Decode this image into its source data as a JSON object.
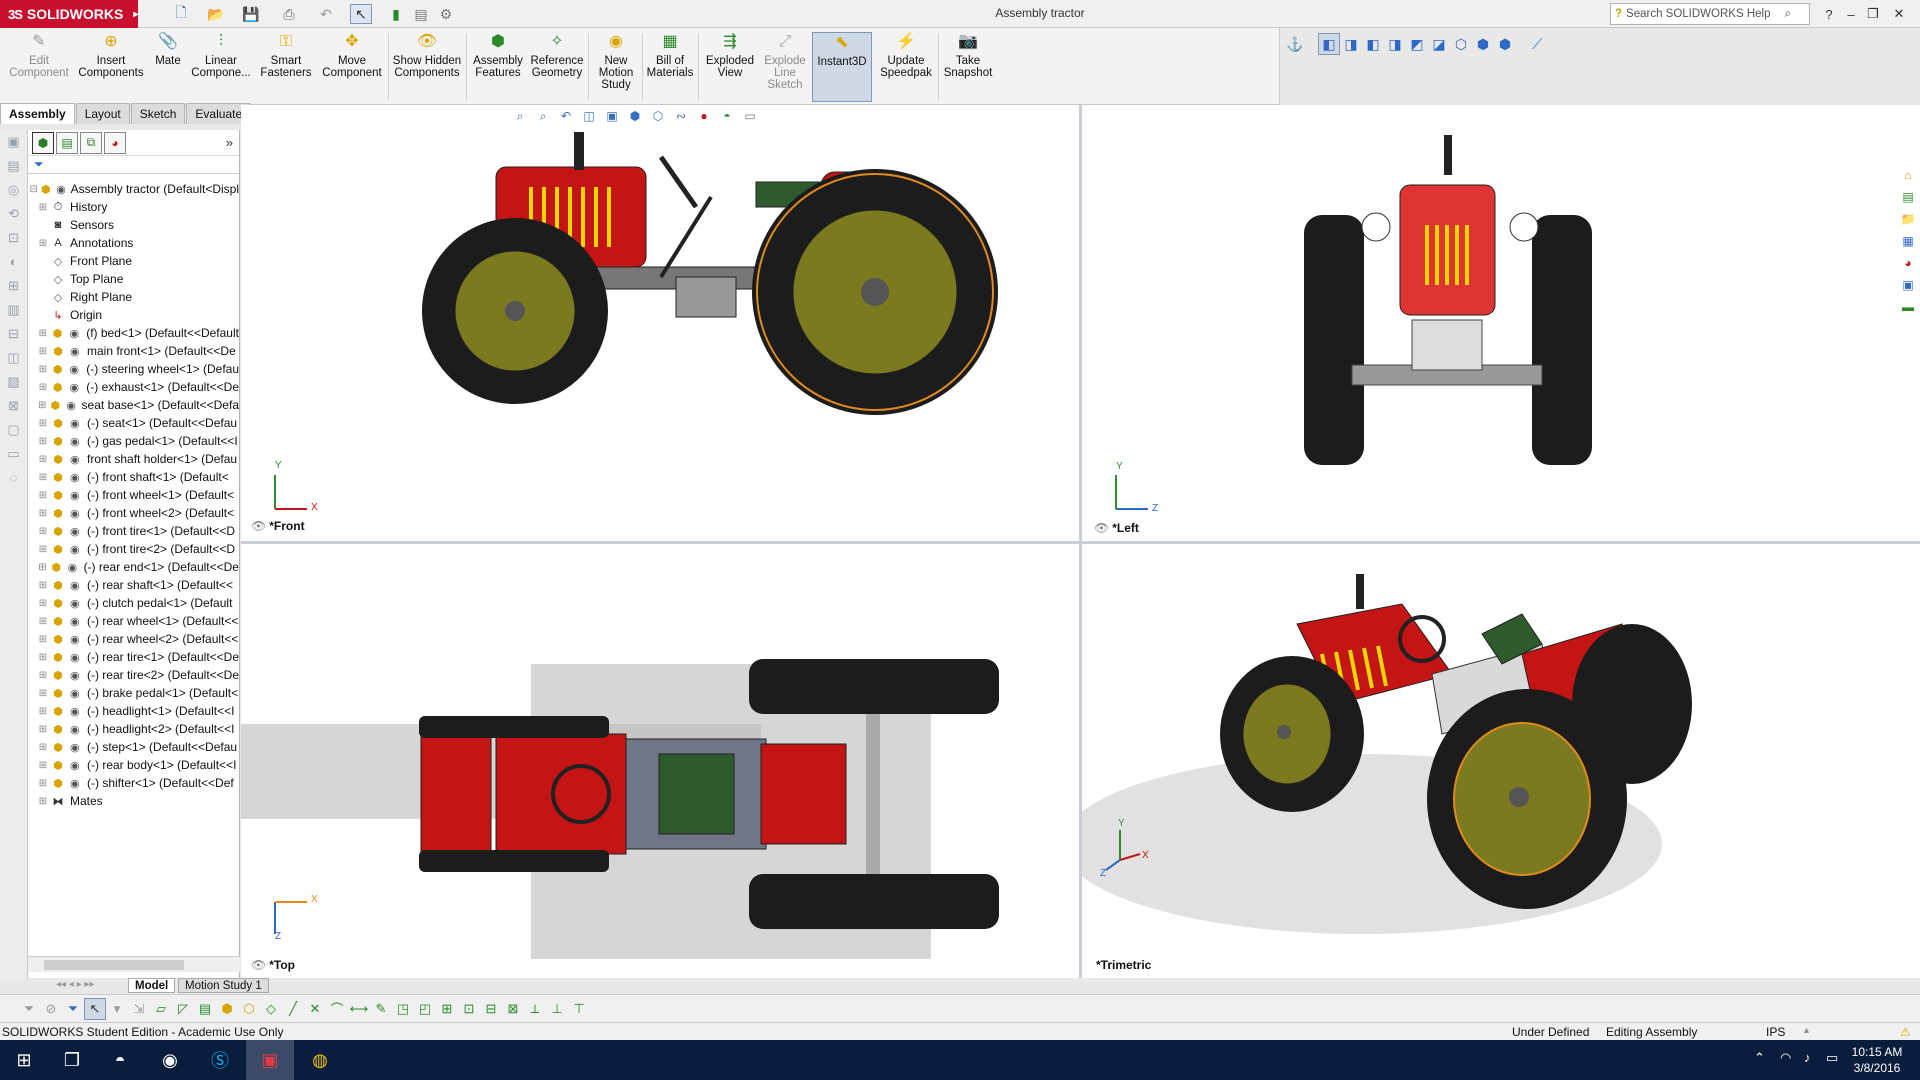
{
  "app": {
    "brand": "SOLIDWORKS",
    "brand_mark": "3S",
    "title": "Assembly tractor"
  },
  "colors": {
    "brand": "#c8102e",
    "tractor_red": "#c41414",
    "wheel_olive": "#7b7a1e",
    "tire": "#1c1c1c",
    "seat_green": "#2e5a2e",
    "accent_blue": "#2f69c5"
  },
  "quick_access": [
    "new-icon",
    "open-icon",
    "save-icon",
    "print-icon",
    "undo-icon",
    "select-icon",
    "rebuild-icon",
    "file-props-icon",
    "options-icon"
  ],
  "search": {
    "placeholder": "Search SOLIDWORKS Help"
  },
  "command_manager": [
    {
      "label": "Edit Component",
      "disabled": true
    },
    {
      "label": "Insert Components",
      "disabled": false
    },
    {
      "label": "Mate",
      "disabled": false
    },
    {
      "label": "Linear Compone...",
      "disabled": false
    },
    {
      "label": "Smart Fasteners",
      "disabled": false
    },
    {
      "label": "Move Component",
      "disabled": false
    },
    {
      "label": "Show Hidden Components",
      "disabled": false
    },
    {
      "label": "Assembly Features",
      "disabled": false
    },
    {
      "label": "Reference Geometry",
      "disabled": false
    },
    {
      "label": "New Motion Study",
      "disabled": false
    },
    {
      "label": "Bill of Materials",
      "disabled": false
    },
    {
      "label": "Exploded View",
      "disabled": false
    },
    {
      "label": "Explode Line Sketch",
      "disabled": true
    },
    {
      "label": "Instant3D",
      "disabled": false,
      "active": true
    },
    {
      "label": "Update Speedpak",
      "disabled": false
    },
    {
      "label": "Take Snapshot",
      "disabled": false
    }
  ],
  "tabs": [
    "Assembly",
    "Layout",
    "Sketch",
    "Evaluate"
  ],
  "feature_tree": {
    "root": "Assembly tractor  (Default<Displ",
    "items": [
      {
        "label": "History",
        "type": "history"
      },
      {
        "label": "Sensors",
        "type": "sensor"
      },
      {
        "label": "Annotations",
        "type": "annotation"
      },
      {
        "label": "Front Plane",
        "type": "plane"
      },
      {
        "label": "Top Plane",
        "type": "plane"
      },
      {
        "label": "Right Plane",
        "type": "plane"
      },
      {
        "label": "Origin",
        "type": "origin"
      },
      {
        "label": "(f) bed<1> (Default<<Default",
        "type": "part"
      },
      {
        "label": "main front<1> (Default<<De",
        "type": "part"
      },
      {
        "label": "(-) steering wheel<1> (Defau",
        "type": "part"
      },
      {
        "label": "(-) exhaust<1> (Default<<De",
        "type": "part"
      },
      {
        "label": "seat base<1> (Default<<Defa",
        "type": "part"
      },
      {
        "label": "(-) seat<1> (Default<<Defau",
        "type": "part"
      },
      {
        "label": "(-) gas pedal<1> (Default<<I",
        "type": "part"
      },
      {
        "label": "front shaft holder<1> (Defau",
        "type": "part"
      },
      {
        "label": "(-) front shaft<1> (Default<",
        "type": "part"
      },
      {
        "label": "(-) front wheel<1> (Default<",
        "type": "part"
      },
      {
        "label": "(-) front wheel<2> (Default<",
        "type": "part"
      },
      {
        "label": "(-) front tire<1> (Default<<D",
        "type": "part"
      },
      {
        "label": "(-) front tire<2> (Default<<D",
        "type": "part"
      },
      {
        "label": "(-) rear end<1> (Default<<De",
        "type": "part"
      },
      {
        "label": "(-) rear shaft<1> (Default<<",
        "type": "part"
      },
      {
        "label": "(-) clutch pedal<1> (Default",
        "type": "part"
      },
      {
        "label": "(-) rear wheel<1> (Default<<",
        "type": "part"
      },
      {
        "label": "(-) rear wheel<2> (Default<<",
        "type": "part"
      },
      {
        "label": "(-) rear tire<1> (Default<<De",
        "type": "part"
      },
      {
        "label": "(-) rear tire<2> (Default<<De",
        "type": "part"
      },
      {
        "label": "(-) brake pedal<1> (Default<",
        "type": "part"
      },
      {
        "label": "(-) headlight<1> (Default<<I",
        "type": "part"
      },
      {
        "label": "(-) headlight<2> (Default<<I",
        "type": "part"
      },
      {
        "label": "(-) step<1> (Default<<Defau",
        "type": "part"
      },
      {
        "label": "(-) rear body<1> (Default<<I",
        "type": "part"
      },
      {
        "label": "(-) shifter<1> (Default<<Def",
        "type": "part"
      },
      {
        "label": "Mates",
        "type": "mates"
      }
    ]
  },
  "viewports": {
    "front": {
      "label": "*Front",
      "axes": [
        "Y",
        "X"
      ]
    },
    "left": {
      "label": "*Left",
      "axes": [
        "Y",
        "Z"
      ]
    },
    "top": {
      "label": "*Top",
      "axes": [
        "Z",
        "X"
      ]
    },
    "trimetric": {
      "label": "*Trimetric",
      "axes": [
        "Y",
        "X",
        "Z"
      ]
    }
  },
  "bottom_tabs": [
    "Model",
    "Motion Study 1"
  ],
  "status": {
    "edition": "SOLIDWORKS Student Edition - Academic Use Only",
    "state": "Under Defined",
    "mode": "Editing Assembly",
    "units": "IPS"
  },
  "taskbar": {
    "time": "10:15 AM",
    "date": "3/8/2016"
  }
}
